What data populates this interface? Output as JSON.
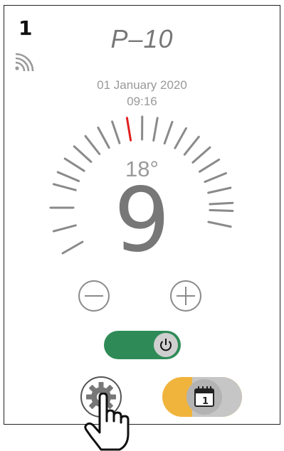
{
  "header": {
    "zone_number": "1",
    "program_name": "P–10"
  },
  "datetime": {
    "date": "01 January 2020",
    "time": "09:16"
  },
  "thermostat": {
    "setpoint_temp": "18°",
    "level": "9",
    "active_tick_color": "#e02020",
    "tick_color": "#8a8a8a"
  },
  "controls": {
    "minus_icon": "minus-circle-icon",
    "plus_icon": "plus-circle-icon",
    "power_toggle": {
      "state": "on",
      "color": "#2e8b57",
      "icon": "power-icon"
    },
    "settings_icon": "gear-icon",
    "calendar_toggle": {
      "icon": "calendar-icon",
      "calendar_day": "1",
      "color": "#f0b43c"
    }
  }
}
